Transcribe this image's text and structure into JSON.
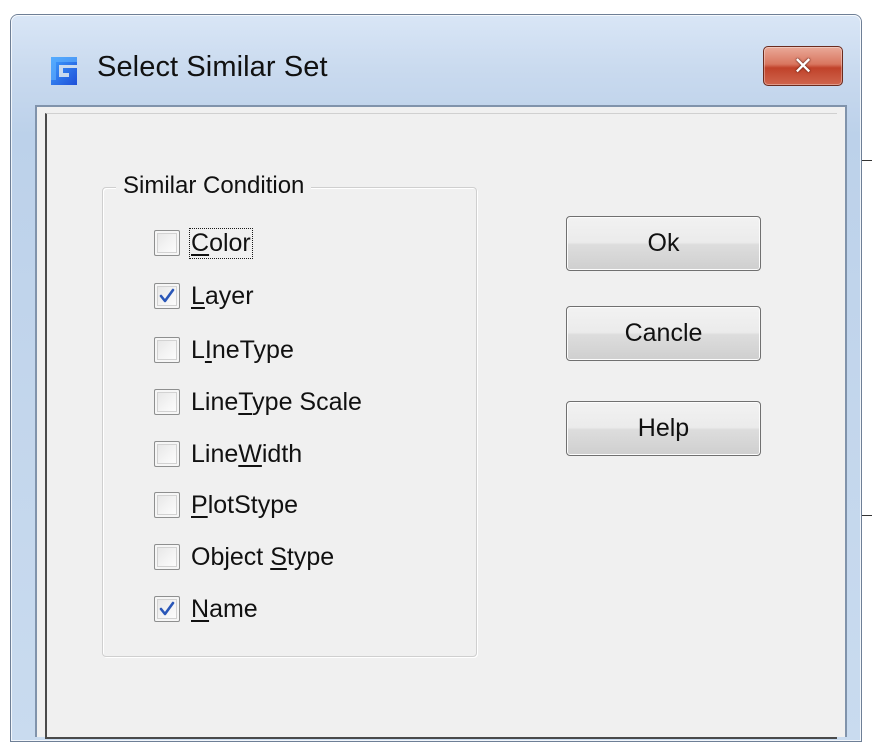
{
  "window": {
    "title": "Select Similar Set",
    "close_label": "✕"
  },
  "group": {
    "label": "Similar Condition",
    "items": [
      {
        "pre": "",
        "mnemonic": "C",
        "post": "olor",
        "checked": false,
        "focused": true
      },
      {
        "pre": "",
        "mnemonic": "L",
        "post": "ayer",
        "checked": true,
        "focused": false
      },
      {
        "pre": "L",
        "mnemonic": "I",
        "post": "neType",
        "checked": false,
        "focused": false
      },
      {
        "pre": "Line",
        "mnemonic": "T",
        "post": "ype Scale",
        "checked": false,
        "focused": false
      },
      {
        "pre": "Line",
        "mnemonic": "W",
        "post": "idth",
        "checked": false,
        "focused": false
      },
      {
        "pre": "",
        "mnemonic": "P",
        "post": "lotStype",
        "checked": false,
        "focused": false
      },
      {
        "pre": "Object ",
        "mnemonic": "S",
        "post": "type",
        "checked": false,
        "focused": false
      },
      {
        "pre": "",
        "mnemonic": "N",
        "post": "ame",
        "checked": true,
        "focused": false
      }
    ]
  },
  "buttons": {
    "ok": "Ok",
    "cancel": "Cancle",
    "help": "Help"
  },
  "colors": {
    "check_mark": "#2a57b8",
    "close_button": "#c7452e",
    "dialog_face": "#f0f0f0"
  },
  "icons": {
    "app": "gstarcad-logo-icon",
    "close": "close-icon",
    "check": "check-icon"
  }
}
